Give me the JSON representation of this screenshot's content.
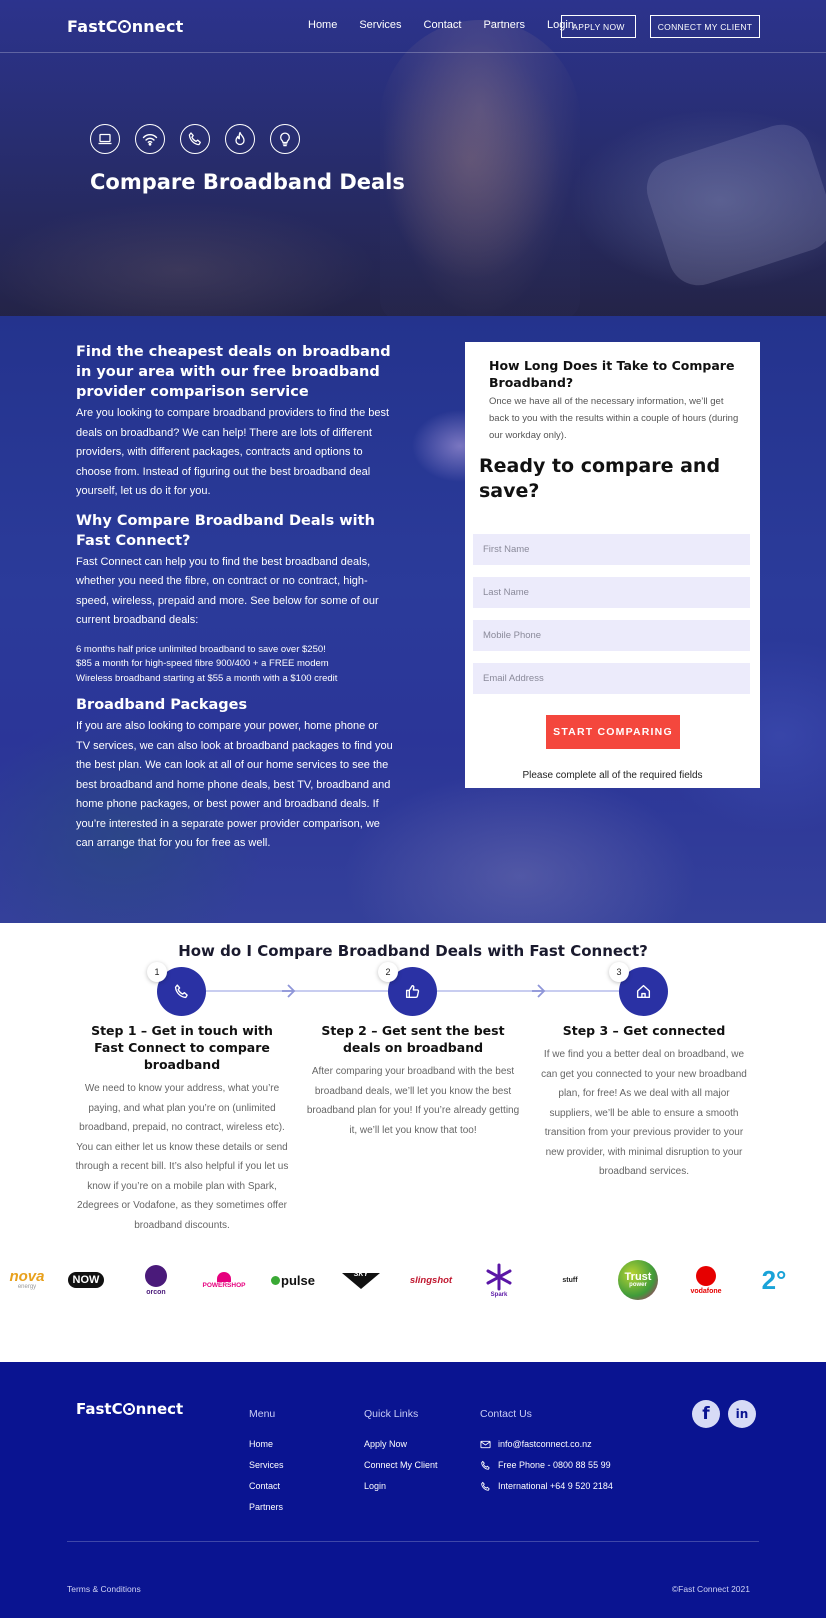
{
  "header": {
    "logo_pre": "Fast",
    "logo_c": "C",
    "logo_post": "nnect",
    "nav": [
      "Home",
      "Services",
      "Contact",
      "Partners",
      "Login"
    ],
    "apply_label": "APPLY NOW",
    "connect_label": "CONNECT MY CLIENT"
  },
  "hero": {
    "icons": [
      "laptop-icon",
      "wifi-icon",
      "phone-icon",
      "flame-icon",
      "lightbulb-icon"
    ],
    "title": "Compare Broadband Deals"
  },
  "content": {
    "intro_heading": "Find the cheapest deals on broadband in your area with our free broadband provider comparison service",
    "intro_text": "Are you looking to compare broadband providers to find the best deals on broadband? We can help! There are lots of different providers, with different packages, contracts and options to choose from. Instead of figuring out the best broadband deal yourself, let us do it for you.",
    "why_heading": "Why Compare Broadband Deals with Fast Connect?",
    "why_text": "Fast Connect can help you to find the best broadband deals, whether you need the fibre, on contract or no contract, high-speed, wireless, prepaid and more. See below for some of our current broadband deals:",
    "deals": [
      "6 months half price unlimited broadband to save over $250!",
      "$85 a month for high-speed fibre 900/400 + a FREE modem",
      "Wireless broadband starting at $55 a month with a $100 credit"
    ],
    "packages_heading": "Broadband Packages",
    "packages_text": "If you are also looking to compare your power, home phone or TV services, we can also look at broadband packages to find you the best plan. We can look at all of our home services to see the best broadband and home phone deals, best TV, broadband and home phone packages, or best power and broadband deals. If you’re interested in a separate power provider comparison, we can arrange that for you for free as well."
  },
  "form": {
    "wait_heading": "How Long Does it Take to Compare Broadband?",
    "wait_text": "Once we have all of the necessary information, we’ll get back to you with the results within a couple of hours (during our workday only).",
    "heading": "Ready to compare and save?",
    "first_name_placeholder": "First Name",
    "last_name_placeholder": "Last Name",
    "mobile_placeholder": "Mobile Phone",
    "email_placeholder": "Email Address",
    "submit_label": "START COMPARING",
    "required_note": "Please complete all of the required fields"
  },
  "steps": {
    "title": "How do I Compare Broadband Deals with Fast Connect?",
    "items": [
      {
        "number": "1",
        "icon": "phone-icon",
        "heading": "Step 1 – Get in touch with Fast Connect to compare broadband",
        "text": "We need to know your address, what you’re paying, and what plan you’re on (unlimited broadband, prepaid, no contract, wireless etc). You can either let us know these details or send through a recent bill. It’s also helpful if you let us know if you’re on a mobile plan with Spark, 2degrees or Vodafone, as they sometimes offer broadband discounts."
      },
      {
        "number": "2",
        "icon": "thumbs-up-icon",
        "heading": "Step 2 – Get sent the best deals on broadband",
        "text": "After comparing your broadband with the best broadband deals, we’ll let you know the best broadband plan for you! If you’re already getting it, we’ll let you know that too!"
      },
      {
        "number": "3",
        "icon": "home-icon",
        "heading": "Step 3 – Get connected",
        "text": "If we find you a better deal on broadband, we can get you connected to your new broadband plan, for free! As we deal with all major suppliers, we’ll be able to ensure a smooth transition from your previous provider to your new provider, with minimal disruption to your broadband services."
      }
    ]
  },
  "partners": {
    "logos": [
      {
        "name": "nova-logo",
        "main": "nova",
        "sub": "energy",
        "color": "#e8a11d"
      },
      {
        "name": "now-logo",
        "main": "NOW",
        "sub": "",
        "color": "#111111"
      },
      {
        "name": "orcon-logo",
        "main": "",
        "sub": "orcon",
        "color": "#4a1a7a"
      },
      {
        "name": "powershop-logo",
        "main": "",
        "sub": "POWERSHOP",
        "color": "#e6007e"
      },
      {
        "name": "pulse-logo",
        "main": "pulse",
        "sub": "",
        "color": "#111111"
      },
      {
        "name": "sky-logo",
        "main": "SKY",
        "sub": "",
        "color": "#111111"
      },
      {
        "name": "slingshot-logo",
        "main": "slingshot",
        "sub": "",
        "color": "#c0172f"
      },
      {
        "name": "spark-logo",
        "main": "",
        "sub": "Spark",
        "color": "#5a16a6"
      },
      {
        "name": "stuff-fibre-logo",
        "main": "stuff",
        "sub": "",
        "color": "#222222"
      },
      {
        "name": "trustpower-logo",
        "main": "Trust",
        "sub": "power",
        "color": "#7ab929"
      },
      {
        "name": "vodafone-logo",
        "main": "",
        "sub": "vodafone",
        "color": "#e60000"
      },
      {
        "name": "2degrees-logo",
        "main": "2°",
        "sub": "",
        "color": "#1aa3d8"
      }
    ]
  },
  "footer": {
    "logo_pre": "Fast",
    "logo_c": "C",
    "logo_post": "nnect",
    "menu_heading": "Menu",
    "menu": [
      "Home",
      "Services",
      "Contact",
      "Partners"
    ],
    "quick_heading": "Quick Links",
    "quick": [
      "Apply Now",
      "Connect My Client",
      "Login"
    ],
    "contact_heading": "Contact Us",
    "email": "info@fastconnect.co.nz",
    "phone": "Free Phone - 0800 88 55 99",
    "international": "International +64 9 520 2184",
    "social": [
      "facebook-icon",
      "linkedin-icon"
    ],
    "terms": "Terms & Conditions",
    "copyright": "©Fast Connect 2021"
  }
}
